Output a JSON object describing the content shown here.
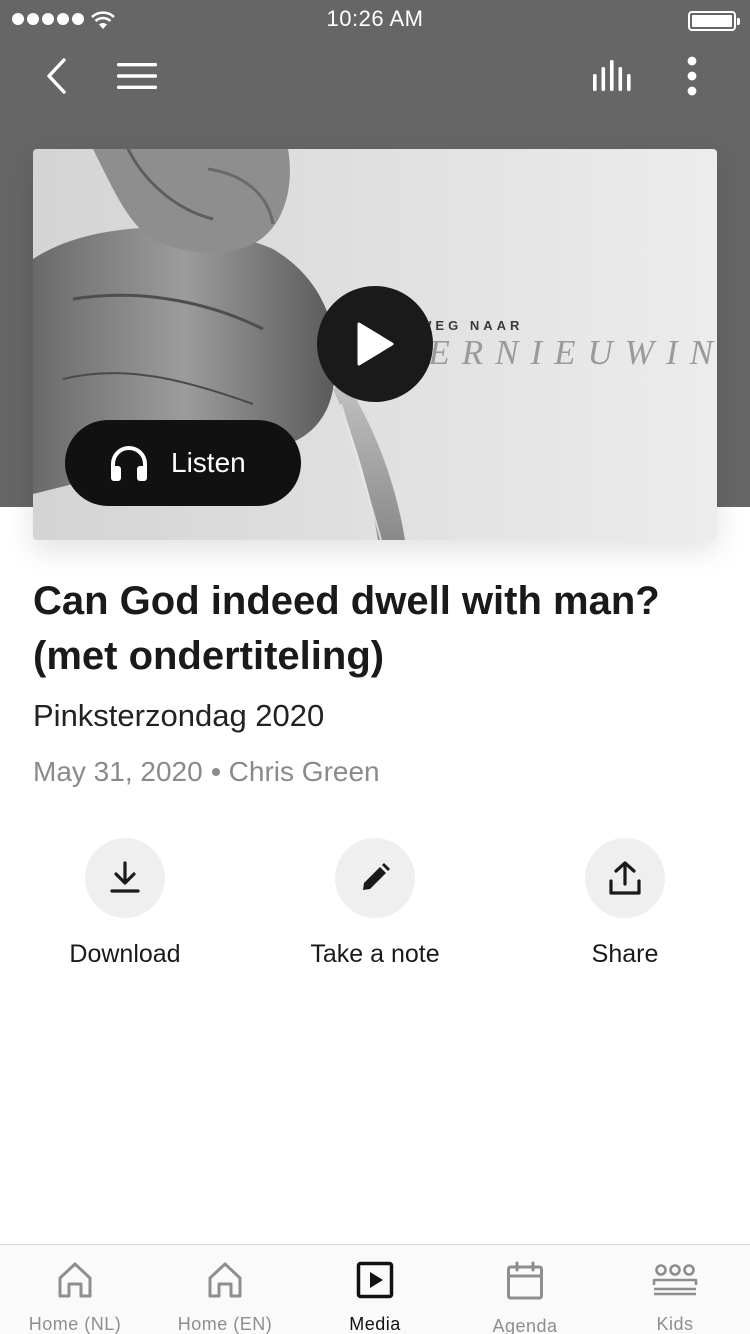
{
  "status_bar": {
    "time": "10:26 AM"
  },
  "nav": {
    "back_icon": "chevron-left-icon",
    "menu_icon": "hamburger-menu-icon",
    "stats_icon": "audio-levels-icon",
    "more_icon": "more-vertical-icon"
  },
  "hero": {
    "artwork_overline": "OP WEG NAAR",
    "artwork_word": "VERNIEUWING",
    "play_icon": "play-icon",
    "listen_label": "Listen",
    "listen_icon": "headphones-icon"
  },
  "sermon": {
    "title": "Can God indeed dwell with man? (met ondertiteling)",
    "series": "Pinksterzondag 2020",
    "date": "May 31, 2020",
    "speaker": "Chris Green"
  },
  "actions": [
    {
      "label": "Download",
      "icon": "download-icon"
    },
    {
      "label": "Take a note",
      "icon": "pencil-icon"
    },
    {
      "label": "Share",
      "icon": "share-icon"
    }
  ],
  "tabs": [
    {
      "label": "Home (NL)",
      "icon": "home-icon",
      "active": false
    },
    {
      "label": "Home (EN)",
      "icon": "home-icon",
      "active": false
    },
    {
      "label": "Media",
      "icon": "media-play-icon",
      "active": true
    },
    {
      "label": "Agenda",
      "icon": "calendar-icon",
      "active": false
    },
    {
      "label": "Kids",
      "icon": "group-icon",
      "active": false
    }
  ],
  "colors": {
    "header_background": "#666666",
    "text_primary": "#1a1a1a",
    "text_secondary": "#8a8a8a",
    "tab_inactive": "#8e8e8e",
    "tab_active": "#111111",
    "action_circle": "#efefef"
  }
}
